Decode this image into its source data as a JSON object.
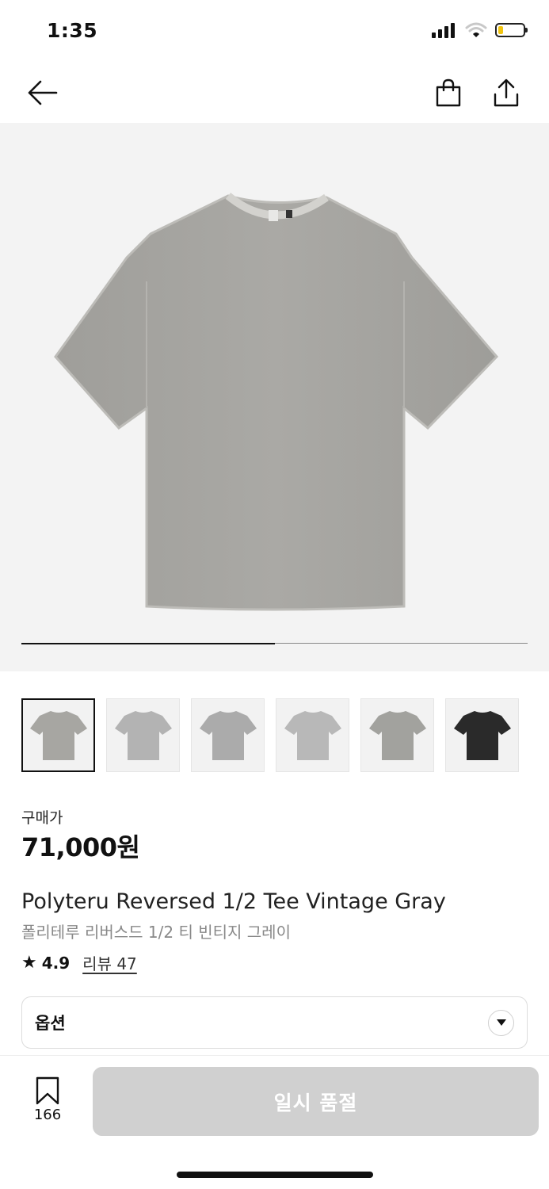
{
  "status_bar": {
    "time": "1:35",
    "battery_level": 0.2
  },
  "nav": {
    "back_icon": "arrow-left-icon",
    "cart_icon": "shopping-bag-icon",
    "share_icon": "share-upload-icon"
  },
  "gallery": {
    "current_image": 1,
    "progress": 0.5
  },
  "thumbnails": [
    {
      "color": "#a7a6a2",
      "active": true
    },
    {
      "color": "#b3b3b3",
      "active": false
    },
    {
      "color": "#ababab",
      "active": false
    },
    {
      "color": "#b8b8b8",
      "active": false
    },
    {
      "color": "#a2a29e",
      "active": false
    },
    {
      "color": "#2a2a2a",
      "active": false
    }
  ],
  "product": {
    "price_label": "구매가",
    "price": "71,000원",
    "name_en": "Polyteru Reversed 1/2 Tee Vintage Gray",
    "name_ko": "폴리테루 리버스드 1/2 티 빈티지 그레이",
    "rating": "4.9",
    "review_link": "리뷰 47"
  },
  "option": {
    "label": "옵션"
  },
  "bottom_bar": {
    "wishlist_count": "166",
    "buy_label": "일시 품절"
  },
  "colors": {
    "shirt": "#a9a8a4",
    "button_disabled": "#d0d0d0",
    "battery": "#f1c40f"
  }
}
